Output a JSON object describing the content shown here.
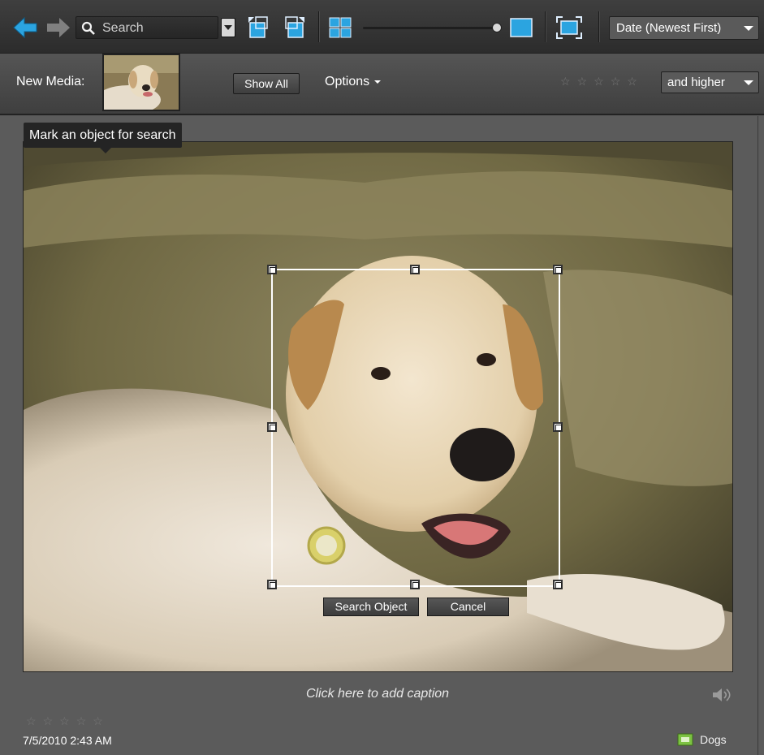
{
  "toolbar": {
    "search_placeholder": "Search",
    "sort_value": "Date (Newest First)"
  },
  "media_bar": {
    "new_media_label": "New Media:",
    "show_all_label": "Show All",
    "options_label": "Options",
    "rating_filter_stars": 5,
    "rating_qualifier": "and higher"
  },
  "viewer": {
    "tooltip": "Mark an object for search",
    "search_object_label": "Search Object",
    "cancel_label": "Cancel",
    "caption_prompt": "Click here to add caption",
    "rating_stars": 5,
    "date": "7/5/2010 2:43 AM",
    "tag": "Dogs"
  },
  "colors": {
    "accent_blue": "#2ba4e0",
    "tag_green": "#7cc242"
  }
}
